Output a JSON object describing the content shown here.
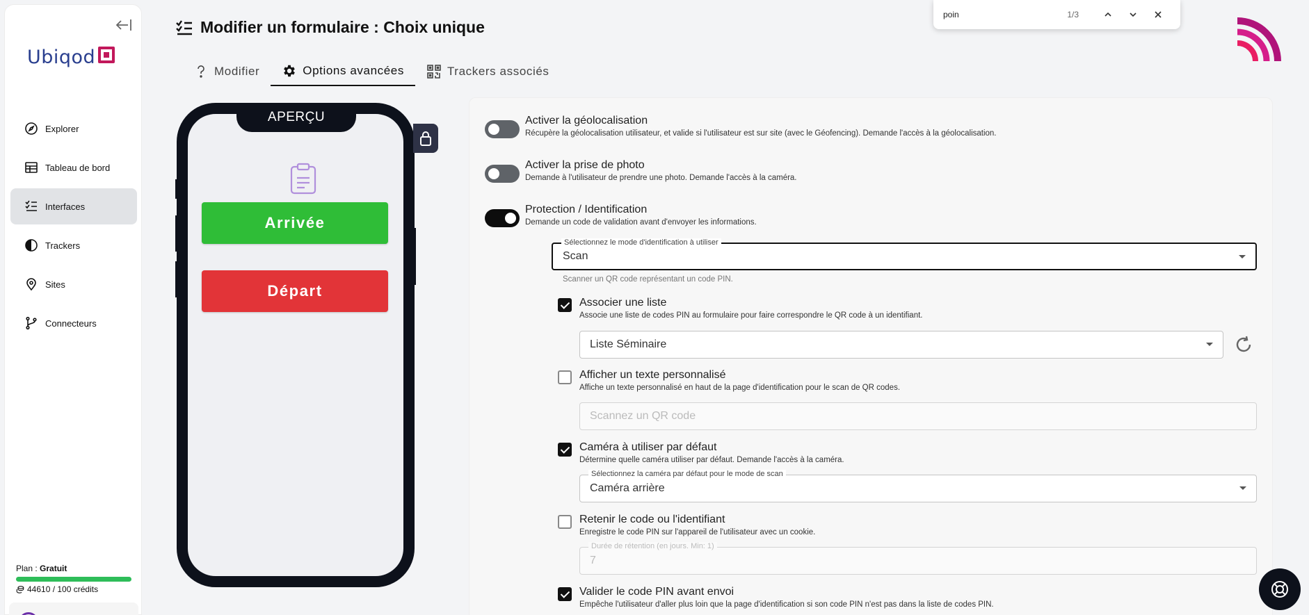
{
  "app": {
    "brand": "Ubiqod"
  },
  "sidebar": {
    "items": [
      {
        "label": "Explorer",
        "icon": "compass-icon"
      },
      {
        "label": "Tableau de bord",
        "icon": "dashboard-icon"
      },
      {
        "label": "Interfaces",
        "icon": "checklist-icon",
        "active": true
      },
      {
        "label": "Trackers",
        "icon": "contrast-icon"
      },
      {
        "label": "Sites",
        "icon": "map-pin-icon"
      },
      {
        "label": "Connecteurs",
        "icon": "git-branch-icon"
      }
    ],
    "plan_prefix": "Plan : ",
    "plan_name": "Gratuit",
    "credits": "44610 / 100 crédits"
  },
  "header": {
    "title": "Modifier un formulaire : Choix unique",
    "tabs": [
      {
        "label": "Modifier",
        "icon": "question-icon"
      },
      {
        "label": "Options avancées",
        "icon": "gear-icon",
        "active": true
      },
      {
        "label": "Trackers associés",
        "icon": "qr-code-icon"
      }
    ]
  },
  "findbar": {
    "query": "poin",
    "count": "1/3"
  },
  "preview": {
    "label": "APERÇU",
    "buttons": [
      {
        "label": "Arrivée",
        "color": "#2fbd37"
      },
      {
        "label": "Départ",
        "color": "#e23438"
      }
    ]
  },
  "options": {
    "geoloc": {
      "title": "Activer la géolocalisation",
      "desc": "Récupère la géolocalisation utilisateur, et valide si l'utilisateur est sur site (avec le Géofencing). Demande l'accès à la géolocalisation.",
      "enabled": false
    },
    "photo": {
      "title": "Activer la prise de photo",
      "desc": "Demande à l'utilisateur de prendre une photo. Demande l'accès à la caméra.",
      "enabled": false
    },
    "protection": {
      "title": "Protection / Identification",
      "desc": "Demande un code de validation avant d'envoyer les informations.",
      "enabled": true,
      "mode_label": "Sélectionnez le mode d'identification à utiliser",
      "mode_value": "Scan",
      "mode_helper": "Scanner un QR code représentant un code PIN."
    },
    "list": {
      "title": "Associer une liste",
      "desc": "Associe une liste de codes PIN au formulaire pour faire correspondre le QR code à un identifiant.",
      "checked": true,
      "value": "Liste Séminaire"
    },
    "custom_text": {
      "title": "Afficher un texte personnalisé",
      "desc": "Affiche un texte personnalisé en haut de la page d'identification pour le scan de QR codes.",
      "checked": false,
      "placeholder": "Scannez un QR code"
    },
    "camera": {
      "title": "Caméra à utiliser par défaut",
      "desc": "Détermine quelle caméra utiliser par défaut. Demande l'accès à la caméra.",
      "checked": true,
      "select_label": "Sélectionnez la caméra par défaut pour le mode de scan",
      "value": "Caméra arrière"
    },
    "remember": {
      "title": "Retenir le code ou l'identifiant",
      "desc": "Enregistre le code PIN sur l'appareil de l'utilisateur avec un cookie.",
      "checked": false,
      "field_label": "Durée de rétention (en jours. Min: 1)",
      "value": "7"
    },
    "validate_pin": {
      "title": "Valider le code PIN avant envoi",
      "desc": "Empêche l'utilisateur d'aller plus loin que la page d'identification si son code PIN n'est pas dans la liste de codes PIN.",
      "checked": true
    }
  }
}
